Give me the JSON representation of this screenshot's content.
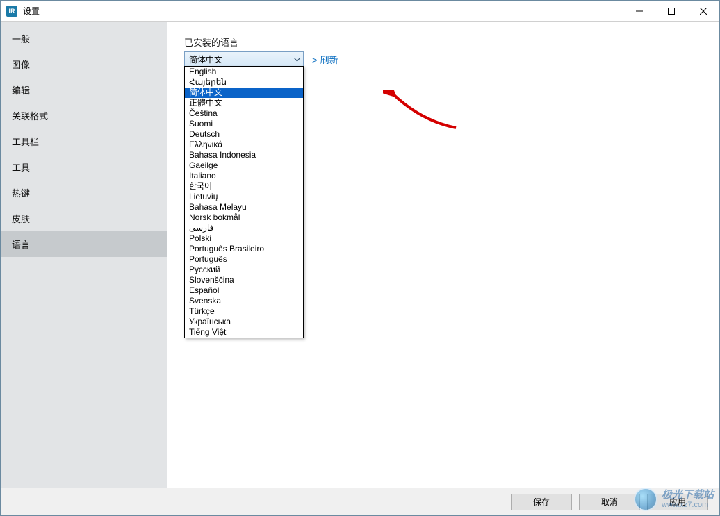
{
  "window": {
    "title": "设置",
    "icon_text": "IR"
  },
  "sidebar": {
    "items": [
      {
        "label": "一般"
      },
      {
        "label": "图像"
      },
      {
        "label": "编辑"
      },
      {
        "label": "关联格式"
      },
      {
        "label": "工具栏"
      },
      {
        "label": "工具"
      },
      {
        "label": "热键"
      },
      {
        "label": "皮肤"
      },
      {
        "label": "语言"
      }
    ],
    "active_index": 8
  },
  "content": {
    "installed_languages_label": "已安装的语言",
    "refresh_label": "刷新",
    "combo_value": "简体中文",
    "languages": [
      "English",
      "Հայերեն",
      "简体中文",
      "正體中文",
      "Čeština",
      "Suomi",
      "Deutsch",
      "Ελληνικά",
      "Bahasa Indonesia",
      "Gaeilge",
      "Italiano",
      "한국어",
      "Lietuvių",
      "Bahasa Melayu",
      "Norsk bokmål",
      "فارسی",
      "Polski",
      "Português Brasileiro",
      "Português",
      "Русский",
      "Slovenščina",
      "Español",
      "Svenska",
      "Türkçe",
      "Українська",
      "Tiếng Việt"
    ],
    "selected_language_index": 2
  },
  "footer": {
    "save": "保存",
    "cancel": "取消",
    "apply": "应用"
  },
  "watermark": {
    "line1": "极光下载站",
    "line2": "www.xz7.com"
  }
}
